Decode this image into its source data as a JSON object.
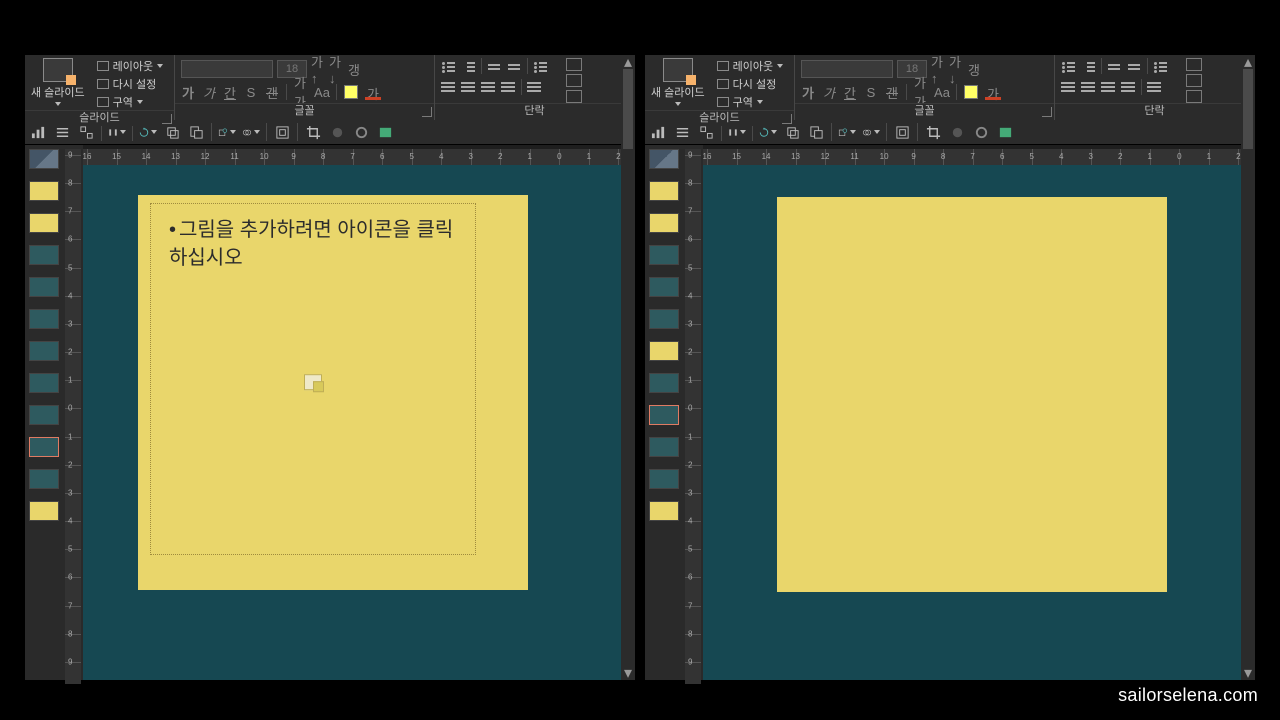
{
  "watermark": "sailorselena.com",
  "ribbon": {
    "slides_group": "슬라이드",
    "font_group": "글꼴",
    "para_group": "단락",
    "new_slide": "새 슬라이드",
    "layout": "레이아웃",
    "reset": "다시 설정",
    "section": "구역",
    "font_size": "18",
    "bold": "가",
    "italic": "가",
    "underline": "간",
    "shadow": "S",
    "strike": "갠",
    "spacing": "가가",
    "hl": "가"
  },
  "left": {
    "slide_text": "그림을 추가하려면 아이콘을 클릭하십시오",
    "hr": [
      "16",
      "15",
      "14",
      "13",
      "12",
      "11",
      "10",
      "9",
      "8",
      "7",
      "6",
      "5",
      "4",
      "3",
      "2",
      "1",
      "0",
      "1",
      "2"
    ],
    "vr": [
      "9",
      "8",
      "7",
      "6",
      "5",
      "4",
      "3",
      "2",
      "1",
      "0",
      "1",
      "2",
      "3",
      "4",
      "5",
      "6",
      "7",
      "8",
      "9"
    ]
  },
  "right": {
    "hr": [
      "16",
      "15",
      "14",
      "13",
      "12",
      "11",
      "10",
      "9",
      "8",
      "7",
      "6",
      "5",
      "4",
      "3",
      "2",
      "1",
      "0",
      "1",
      "2"
    ],
    "vr": [
      "9",
      "8",
      "7",
      "6",
      "5",
      "4",
      "3",
      "2",
      "1",
      "0",
      "1",
      "2",
      "3",
      "4",
      "5",
      "6",
      "7",
      "8",
      "9"
    ]
  }
}
